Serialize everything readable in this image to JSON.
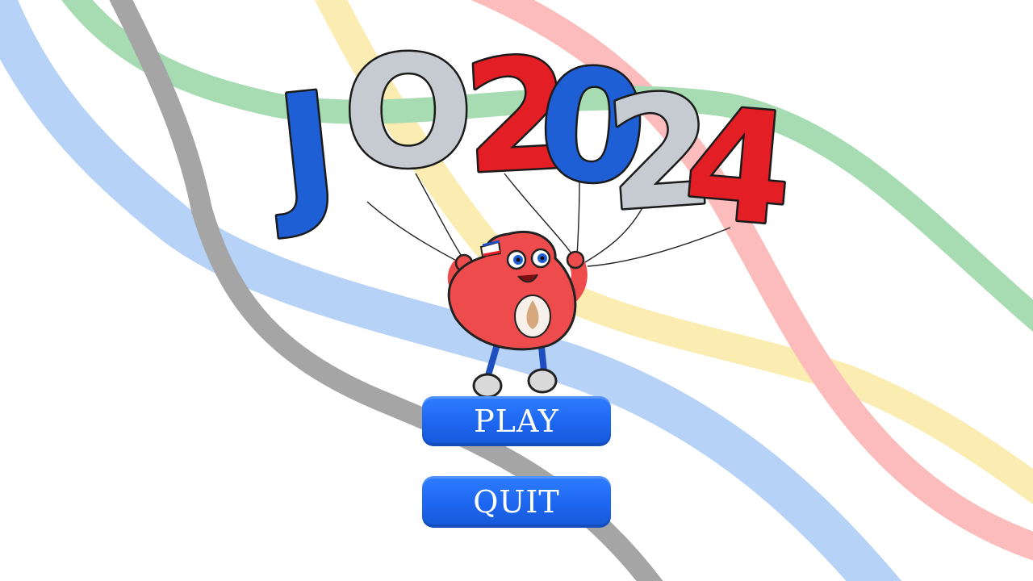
{
  "title": {
    "letters": [
      "J",
      "O",
      "2",
      "0",
      "2",
      "4"
    ]
  },
  "menu": {
    "play_label": "PLAY",
    "quit_label": "QUIT"
  },
  "colors": {
    "ribbon_blue": "#b6d2f6",
    "ribbon_gray": "#a5a5a5",
    "ribbon_green": "#a7dbb1",
    "ribbon_yellow": "#fbecb1",
    "ribbon_red": "#fdbcbc",
    "balloon_blue": "#1f5fd6",
    "balloon_silver": "#c6cad1",
    "balloon_red": "#e31e24",
    "button_blue": "#1d66f0",
    "mascot_red": "#ee4c4c"
  }
}
